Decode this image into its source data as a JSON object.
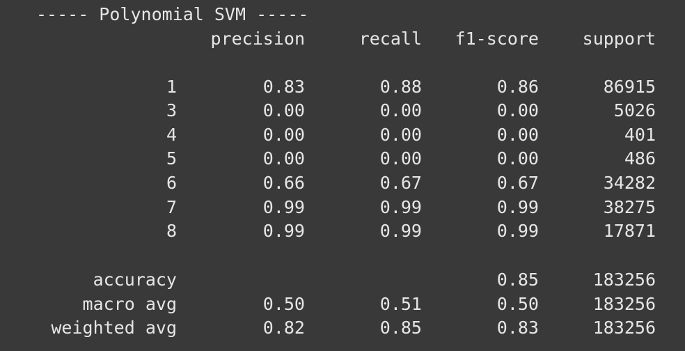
{
  "title": "----- Polynomial SVM -----",
  "headers": {
    "precision": "precision",
    "recall": "recall",
    "f1": "f1-score",
    "support": "support"
  },
  "rows": [
    {
      "label": "1",
      "precision": "0.83",
      "recall": "0.88",
      "f1": "0.86",
      "support": "86915"
    },
    {
      "label": "3",
      "precision": "0.00",
      "recall": "0.00",
      "f1": "0.00",
      "support": "5026"
    },
    {
      "label": "4",
      "precision": "0.00",
      "recall": "0.00",
      "f1": "0.00",
      "support": "401"
    },
    {
      "label": "5",
      "precision": "0.00",
      "recall": "0.00",
      "f1": "0.00",
      "support": "486"
    },
    {
      "label": "6",
      "precision": "0.66",
      "recall": "0.67",
      "f1": "0.67",
      "support": "34282"
    },
    {
      "label": "7",
      "precision": "0.99",
      "recall": "0.99",
      "f1": "0.99",
      "support": "38275"
    },
    {
      "label": "8",
      "precision": "0.99",
      "recall": "0.99",
      "f1": "0.99",
      "support": "17871"
    }
  ],
  "summary": {
    "accuracy": {
      "label": "accuracy",
      "f1": "0.85",
      "support": "183256"
    },
    "macro": {
      "label": "macro avg",
      "precision": "0.50",
      "recall": "0.51",
      "f1": "0.50",
      "support": "183256"
    },
    "weighted": {
      "label": "weighted avg",
      "precision": "0.82",
      "recall": "0.85",
      "f1": "0.83",
      "support": "183256"
    }
  }
}
